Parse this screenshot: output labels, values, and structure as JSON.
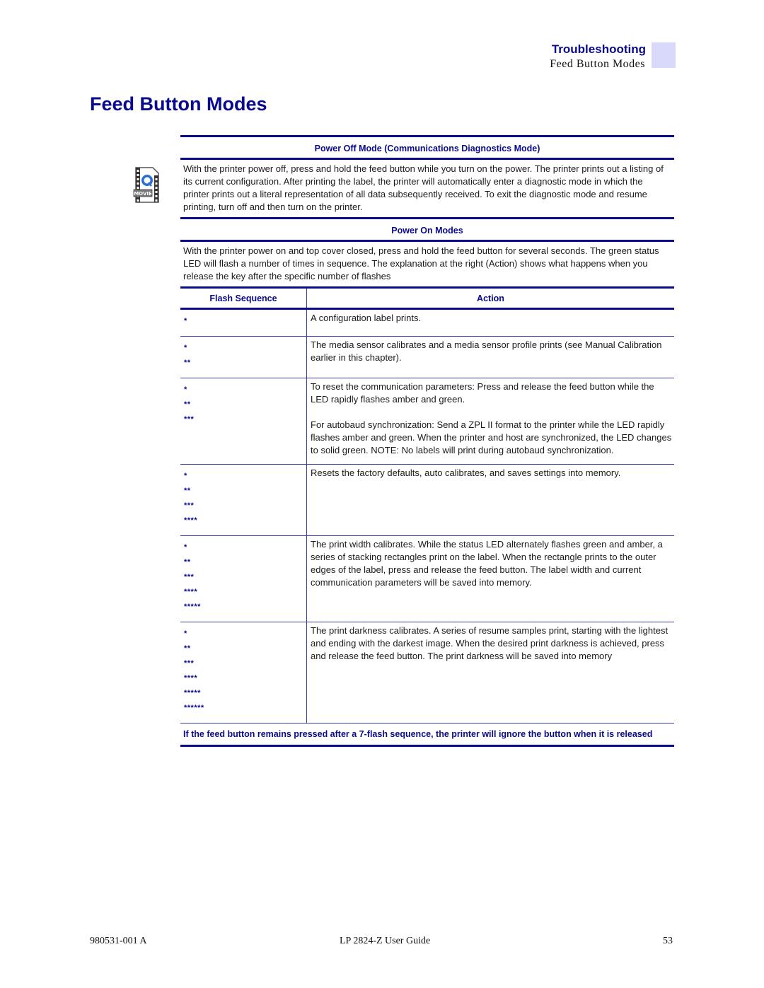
{
  "header": {
    "section": "Troubleshooting",
    "subsection": "Feed Button Modes"
  },
  "page_title": "Feed Button Modes",
  "icons": {
    "movie": "movie-file-icon"
  },
  "power_off": {
    "heading": "Power Off Mode (Communications Diagnostics Mode)",
    "text": "With the printer power off, press and hold the feed button while you turn on the power. The printer prints out a listing of its current configuration. After printing the label, the printer will automatically enter a diagnostic mode in which the printer prints out a literal representation of all data subsequently received. To exit the diagnostic mode and resume printing, turn off and then turn on the printer."
  },
  "power_on": {
    "heading": "Power On Modes",
    "text": "With the printer power on and top cover closed, press and hold the feed button for several seconds. The green status LED will flash a number of times in sequence. The explanation at the right (Action) shows what happens when you release the key after the specific number of flashes"
  },
  "table": {
    "columns": [
      "Flash Sequence",
      "Action"
    ],
    "rows": [
      {
        "sequence": [
          "*"
        ],
        "action": [
          "A configuration label prints."
        ]
      },
      {
        "sequence": [
          "*",
          "**"
        ],
        "action": [
          "The media sensor calibrates and a media sensor profile prints (see Manual Calibration earlier in this chapter)."
        ]
      },
      {
        "sequence": [
          "*",
          "**",
          "***"
        ],
        "action": [
          "To reset the communication parameters: Press and release the feed button while the LED rapidly flashes amber and green.",
          "For autobaud synchronization: Send a ZPL II format to the printer while the LED rapidly flashes amber and green. When the printer and host are synchronized, the LED changes to solid green. NOTE: No labels will print during autobaud synchronization."
        ]
      },
      {
        "sequence": [
          "*",
          "**",
          "***",
          "****"
        ],
        "action": [
          "Resets the factory defaults, auto calibrates, and saves settings into memory."
        ]
      },
      {
        "sequence": [
          "*",
          "**",
          "***",
          "****",
          "*****"
        ],
        "action": [
          "The print width calibrates. While the status LED alternately flashes green and amber, a series of stacking rectangles print on the label. When the rectangle prints to the outer edges of the label, press and release the feed button. The label width and current communication parameters will be saved into memory."
        ]
      },
      {
        "sequence": [
          "*",
          "**",
          "***",
          "****",
          "*****",
          "******"
        ],
        "action": [
          "The print darkness calibrates. A series of resume samples print, starting with the lightest and ending with the darkest image. When the desired print darkness is achieved, press and release the feed button. The print darkness will be saved into memory"
        ]
      }
    ]
  },
  "note": "If the feed button remains pressed after a 7-flash sequence, the printer will ignore the button when it is released",
  "footer": {
    "doc_number": "980531-001 A",
    "guide_title": "LP 2824-Z User Guide",
    "page_number": "53"
  }
}
